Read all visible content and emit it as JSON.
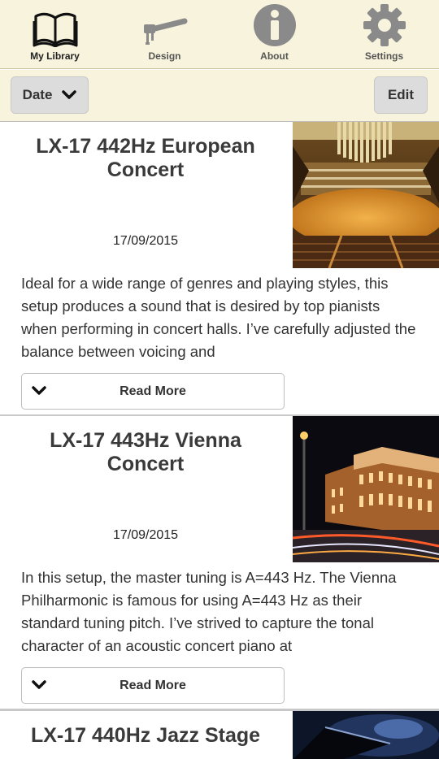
{
  "tabs": [
    {
      "label": "My Library",
      "icon": "book-icon"
    },
    {
      "label": "Design",
      "icon": "tuning-hammer-icon"
    },
    {
      "label": "About",
      "icon": "info-icon"
    },
    {
      "label": "Settings",
      "icon": "gear-icon"
    }
  ],
  "toolbar": {
    "sort_label": "Date",
    "edit_label": "Edit"
  },
  "items": [
    {
      "title": "LX-17 442Hz  European Concert",
      "date": "17/09/2015",
      "description": "Ideal for a wide range of genres and playing styles, this setup produces a sound that is desired by top pianists when performing in concert halls. I’ve carefully adjusted the balance between voicing and",
      "read_more": "Read More",
      "image": "concert-hall-photo"
    },
    {
      "title": "LX-17 443Hz  Vienna Concert",
      "date": "17/09/2015",
      "description": "In this setup, the master tuning is A=443 Hz. The Vienna Philharmonic is famous for using A=443 Hz as their standard tuning pitch. I’ve strived to capture the tonal character of an acoustic concert piano at",
      "read_more": "Read More",
      "image": "vienna-musikverein-night-photo"
    },
    {
      "title": "LX-17 440Hz  Jazz Stage",
      "image": "jazz-stage-piano-photo"
    }
  ],
  "colors": {
    "bar_bg": "#f7f3dc",
    "button_bg": "#dcdcdc",
    "icon_gray": "#8a8a8a",
    "text": "#333333"
  }
}
